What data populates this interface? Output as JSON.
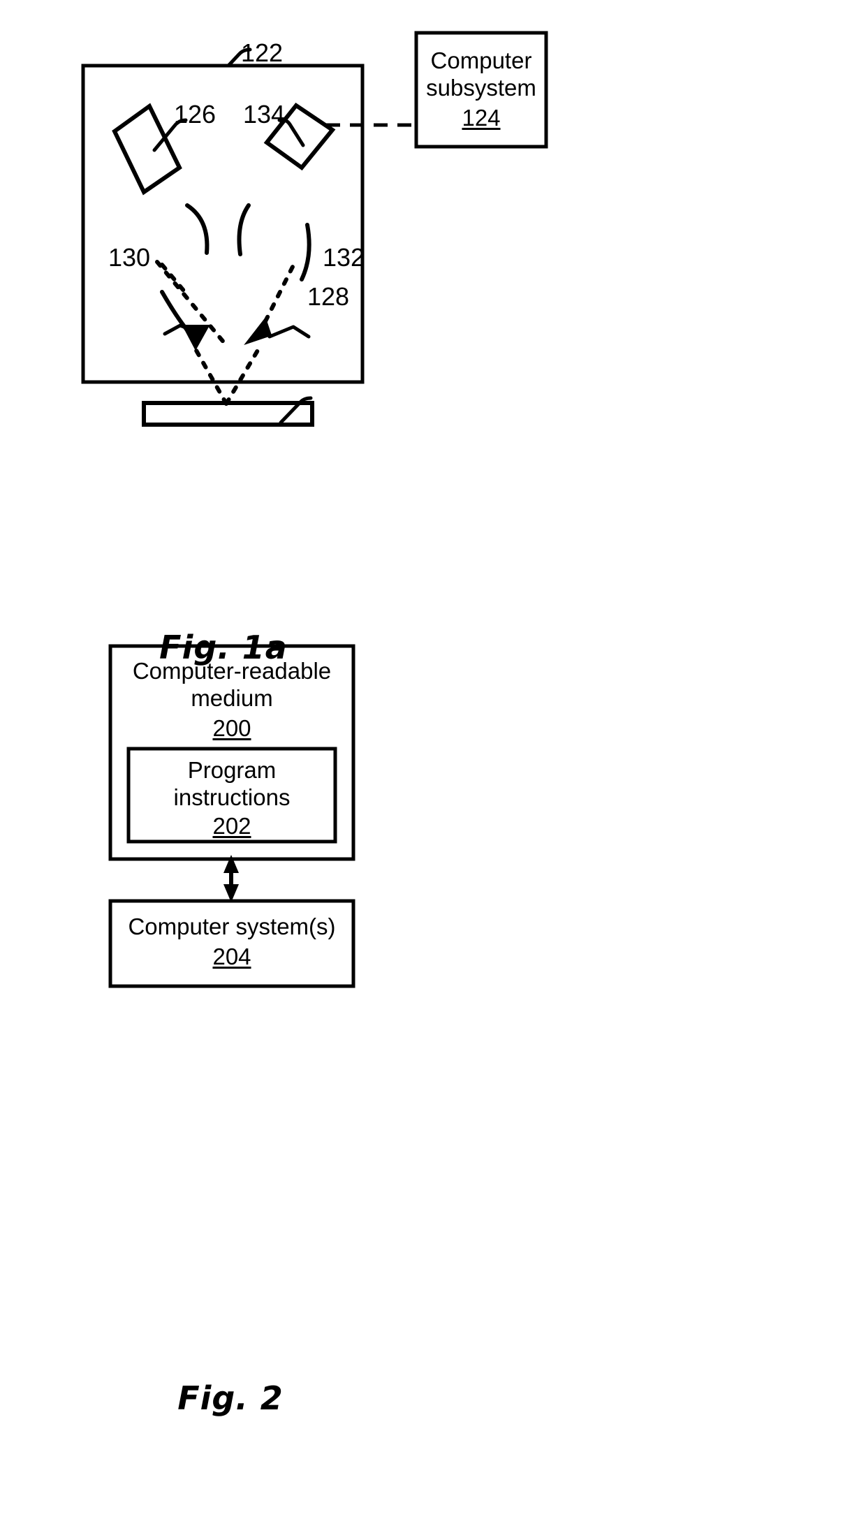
{
  "document": {
    "type": "patent-drawing-sheet",
    "background_color": "#ffffff",
    "line_color": "#000000"
  },
  "figure1a": {
    "caption": "Fig. 1a",
    "inspection_system": {
      "reference": "122",
      "label": ""
    },
    "computer_subsystem": {
      "line1": "Computer",
      "line2": "subsystem",
      "reference": "124"
    },
    "illumination_subsystem": {
      "reference": "126"
    },
    "detection_subsystem": {
      "reference": "134"
    },
    "specimen": {
      "reference": "128"
    },
    "illumination_angle": {
      "reference": "130"
    },
    "collection_angle": {
      "reference": "132"
    }
  },
  "figure2": {
    "caption": "Fig. 2",
    "medium_box": {
      "line1": "Computer-readable",
      "line2": "medium",
      "reference": "200"
    },
    "instructions_box": {
      "line1": "Program",
      "line2": "instructions",
      "reference": "202"
    },
    "system_box": {
      "line1": "Computer system(s)",
      "reference": "204"
    }
  }
}
